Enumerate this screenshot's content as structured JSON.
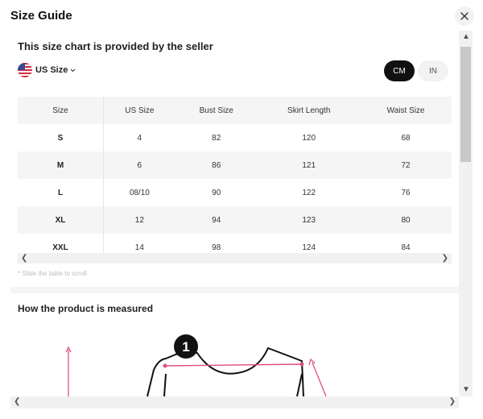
{
  "modal": {
    "title": "Size Guide"
  },
  "size_chart": {
    "seller_note": "This size chart is provided by the seller",
    "size_system": "US Size",
    "units": [
      "CM",
      "IN"
    ],
    "active_unit": "CM",
    "columns": [
      "Size",
      "US Size",
      "Bust Size",
      "Skirt Length",
      "Waist Size"
    ],
    "rows": [
      [
        "S",
        "4",
        "82",
        "120",
        "68"
      ],
      [
        "M",
        "6",
        "86",
        "121",
        "72"
      ],
      [
        "L",
        "08/10",
        "90",
        "122",
        "76"
      ],
      [
        "XL",
        "12",
        "94",
        "123",
        "80"
      ],
      [
        "XXL",
        "14",
        "98",
        "124",
        "84"
      ]
    ],
    "scroll_hint": "* Slide the table to scroll"
  },
  "measurement": {
    "title": "How the product is measured",
    "marker": "1"
  },
  "colors": {
    "accent": "#e0507a",
    "toggle_active": "#111111"
  },
  "icons": [
    "close-icon",
    "us-flag-icon",
    "chevron-down-icon",
    "chevron-left-icon",
    "chevron-right-icon",
    "chevron-up-icon"
  ]
}
